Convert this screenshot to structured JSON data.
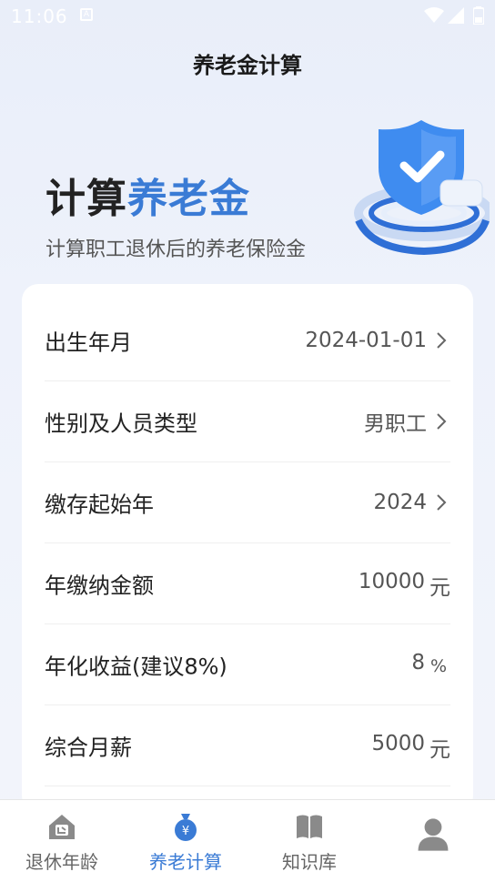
{
  "status_bar": {
    "time": "11:06"
  },
  "header": {
    "title": "养老金计算"
  },
  "hero": {
    "title_part1": "计算",
    "title_part2": "养老金",
    "subtitle": "计算职工退休后的养老保险金"
  },
  "form": {
    "rows": [
      {
        "label": "出生年月",
        "value": "2024-01-01"
      },
      {
        "label": "性别及人员类型",
        "value": "男职工"
      },
      {
        "label": "缴存起始年",
        "value": "2024"
      },
      {
        "label": "年缴纳金额",
        "value": "10000",
        "unit": "元"
      },
      {
        "label": "年化收益(建议8%)",
        "value": "8",
        "unit": "%"
      },
      {
        "label": "综合月薪",
        "value": "5000",
        "unit": "元"
      }
    ]
  },
  "tabbar": {
    "tabs": [
      {
        "label": "退休年龄",
        "icon": "house-icon"
      },
      {
        "label": "养老计算",
        "icon": "money-bag-icon"
      },
      {
        "label": "知识库",
        "icon": "book-icon"
      },
      {
        "label": "",
        "icon": "user-icon"
      }
    ]
  },
  "colors": {
    "accent": "#3a7bd5",
    "background": "#edf1fa"
  }
}
